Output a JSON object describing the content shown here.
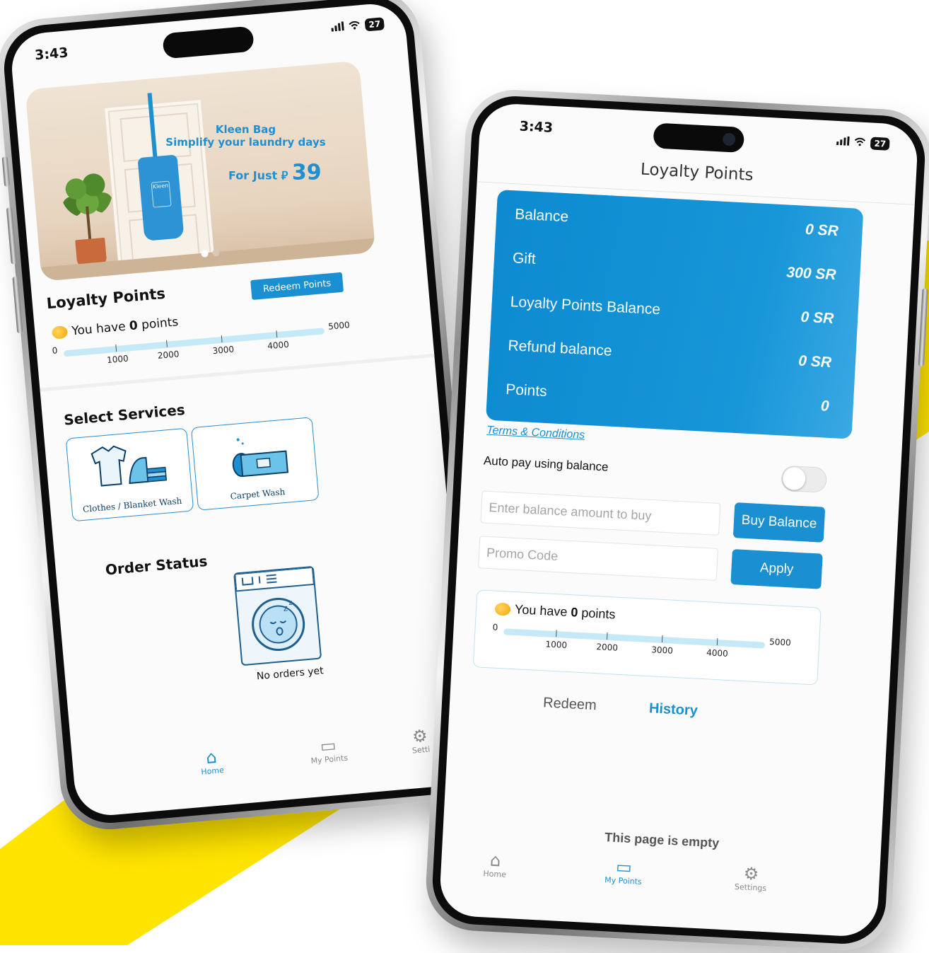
{
  "left_phone": {
    "status": {
      "time": "3:43",
      "signal": "▐▌",
      "battery": "27"
    },
    "banner": {
      "title_line1": "Kleen Bag",
      "title_line2": "Simplify your laundry days",
      "price_prefix": "For Just ⃁",
      "price": "39",
      "bag_tag": "Kleen"
    },
    "loyalty": {
      "title": "Loyalty Points",
      "redeem_label": "Redeem Points",
      "have_prefix": "You have",
      "points": "0",
      "have_suffix": "points",
      "progress": {
        "min": "0",
        "max": "5000",
        "value": 0,
        "ticks": [
          "1000",
          "2000",
          "3000",
          "4000"
        ]
      }
    },
    "services": {
      "title": "Select Services",
      "items": [
        {
          "label": "Clothes / Blanket Wash",
          "icon": "clothes-iron-icon"
        },
        {
          "label": "Carpet Wash",
          "icon": "carpet-icon"
        }
      ]
    },
    "order_status": {
      "title": "Order Status",
      "empty": "No orders yet",
      "icon": "washing-machine-sleep-icon"
    },
    "tabbar": [
      {
        "label": "Home",
        "icon": "home-icon",
        "active": true
      },
      {
        "label": "My Points",
        "icon": "wallet-icon",
        "active": false
      },
      {
        "label": "Setti",
        "icon": "gear-icon",
        "active": false
      }
    ]
  },
  "right_phone": {
    "status": {
      "time": "3:43",
      "battery": "27"
    },
    "title": "Loyalty Points",
    "balance_card": {
      "rows": [
        {
          "label": "Balance",
          "value": "0 SR"
        },
        {
          "label": "Gift",
          "value": "300 SR"
        },
        {
          "label": "Loyalty Points Balance",
          "value": "0 SR"
        },
        {
          "label": "Refund balance",
          "value": "0 SR"
        },
        {
          "label": "Points",
          "value": "0"
        }
      ]
    },
    "terms_label": "Terms & Conditions",
    "autopay_label": "Auto pay using balance",
    "autopay_on": false,
    "balance_input": {
      "value": "",
      "placeholder": "Enter balance amount to buy"
    },
    "buy_label": "Buy Balance",
    "promo_input": {
      "value": "",
      "placeholder": "Promo Code"
    },
    "apply_label": "Apply",
    "points_box": {
      "have_prefix": "You have",
      "points": "0",
      "have_suffix": "points",
      "progress": {
        "min": "0",
        "max": "5000",
        "value": 0,
        "ticks": [
          "1000",
          "2000",
          "3000",
          "4000"
        ]
      }
    },
    "tabs": {
      "redeem": "Redeem",
      "history": "History",
      "active": "History"
    },
    "empty_message": "This page is empty",
    "tabbar": [
      {
        "label": "Home",
        "icon": "home-icon",
        "active": false
      },
      {
        "label": "My Points",
        "icon": "wallet-icon",
        "active": true
      },
      {
        "label": "Settings",
        "icon": "gear-icon",
        "active": false
      }
    ]
  },
  "colors": {
    "accent": "#1a8fd1",
    "background_shape": "#FFE400",
    "card": "#0d8ad0"
  }
}
